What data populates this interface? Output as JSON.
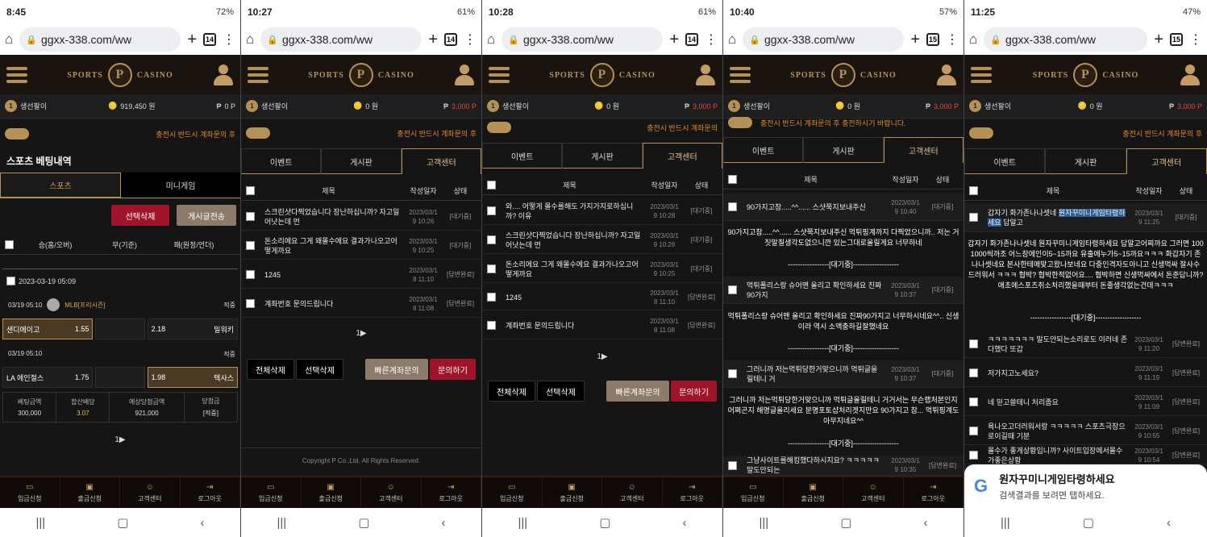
{
  "phones": [
    {
      "time": "8:45",
      "battery": "72%",
      "url": "ggxx-338.com/ww",
      "tabs": "14",
      "nick": "생선팔이",
      "money": "919,450 원",
      "points": "0 P"
    },
    {
      "time": "10:27",
      "battery": "61%",
      "url": "ggxx-338.com/ww",
      "tabs": "14",
      "nick": "생선팔이",
      "money": "0 원",
      "points": "3,000 P"
    },
    {
      "time": "10:28",
      "battery": "61%",
      "url": "ggxx-338.com/ww",
      "tabs": "14",
      "nick": "생선팔이",
      "money": "0 원",
      "points": "3,000 P"
    },
    {
      "time": "10:40",
      "battery": "57%",
      "url": "ggxx-338.com/ww",
      "tabs": "15",
      "nick": "생선팔이",
      "money": "0 원",
      "points": "3,000 P"
    },
    {
      "time": "11:25",
      "battery": "47%",
      "url": "ggxx-338.com/ww",
      "tabs": "15",
      "nick": "생선팔이",
      "money": "0 원",
      "points": "3,000 P"
    }
  ],
  "brand": {
    "left": "SPORTS",
    "right": "CASINO",
    "seal": "P"
  },
  "notice": "충전시 반드시 계좌문의 후 충전하시기 바랍니다.",
  "notice_short": "충전시 반드시 계좌문의 후",
  "notice_mid": "충전시 반드시 계좌문의",
  "sports": {
    "title": "스포츠 베팅내역",
    "tab_sports": "스포츠",
    "tab_mini": "미니게임",
    "btn_delete": "선택삭제",
    "btn_send": "게시글전송",
    "h_home": "승(홈/오버)",
    "h_draw": "무(기준)",
    "h_away": "패(원정/언더)",
    "date": "2023-03-19 05:09",
    "g1_time": "03/19  05:10",
    "g1_league": "MLB[프리시즌]",
    "g1_status": "적중",
    "g1_home": "샌디에이고",
    "g1_home_odd": "1.55",
    "g1_away_odd": "2.18",
    "g1_away": "밀워키",
    "g2_time": "03/19  05:10",
    "g2_status": "적중",
    "g2_home": "LA 에인절스",
    "g2_home_odd": "1.75",
    "g2_away_odd": "1.98",
    "g2_away": "텍사스",
    "s_bet": "베팅금액",
    "s_bet_v": "300,000",
    "s_odds": "합산배당",
    "s_odds_v": "3.07",
    "s_exp": "예상당첨금액",
    "s_exp_v": "921,000",
    "s_win": "당첨금",
    "s_win_v": "[적중]",
    "pager": "1▶"
  },
  "tabs": {
    "event": "이벤트",
    "board": "게시판",
    "cs": "고객센터"
  },
  "thead": {
    "title": "제목",
    "date": "작성일자",
    "status": "상태"
  },
  "p2rows": [
    {
      "t": "스크린샷다찍었습니다 장난하십니까? 자고일어낫는데 먼",
      "d1": "2023/03/1",
      "d2": "9 10:26",
      "s": "[대기중]"
    },
    {
      "t": "돈소리에요 그게 왜몰수에요 결과가나오고어떻게까요",
      "d1": "2023/03/1",
      "d2": "9 10:25",
      "s": "[대기중]"
    },
    {
      "t": "1245",
      "d1": "2023/03/1",
      "d2": "8 11:10",
      "s": "[답변완료]"
    },
    {
      "t": "계좌번호 문의드립니다",
      "d1": "2023/03/1",
      "d2": "8 11:08",
      "s": "[답변완료]"
    }
  ],
  "p3rows": [
    {
      "t": "와.... 어떻게 몰수를해도 가지가지로하십니까? 이유",
      "d1": "2023/03/1",
      "d2": "9 10:28",
      "s": "[대기중]"
    },
    {
      "t": "스크린샷다찍었습니다 장난하십니까? 자고일어낫는데 먼",
      "d1": "2023/03/1",
      "d2": "9 10:26",
      "s": "[대기중]"
    },
    {
      "t": "돈소리에요 그게 왜몰수에요 결과가나오고어떻게까요",
      "d1": "2023/03/1",
      "d2": "9 10:25",
      "s": "[대기중]"
    },
    {
      "t": "1245",
      "d1": "2023/03/1",
      "d2": "8 11:10",
      "s": "[답변완료]"
    },
    {
      "t": "계좌번호 문의드립니다",
      "d1": "2023/03/1",
      "d2": "8 11:08",
      "s": "[답변완료]"
    }
  ],
  "board_btns": {
    "all": "전체삭제",
    "sel": "선택삭제",
    "quick": "빠른계좌문의",
    "ask": "문의하기"
  },
  "pager": "1▶",
  "copyright": "Copyright P Co.,Ltd. All Rights Reserved.",
  "p4": {
    "r1": "90가지고참.....^^...... 스샷쭉지보내주신",
    "r1d1": "2023/03/1",
    "r1d2": "9 10:40",
    "r1s": "[대기중]",
    "b1": "90가지고참.....^^...... 스샷쭉지보내주신 먹튀핑계까지 다찍었으니까.. 저는 거짓말칠생각도없으니깐 있는그대로올릴게요 너무하네",
    "wait": "-----------------[대기중]-------------------",
    "r2": "먹튀폴리스랑 슈어맨 올리고 확인하세요 진짜 90가지",
    "r2d1": "2023/03/1",
    "r2d2": "9 10:37",
    "r2s": "[대기중]",
    "b2": "먹튀폴리스랑 슈어맨 올리고 확인하세요 진짜90가지고 너무하시네요^^.. 신생이라 역시 소액충하길잘했네요",
    "r3": "그러니까 저는먹튀당한거맞으니까 먹튀글을 릴테니 거",
    "r3d1": "2023/03/1",
    "r3d2": "9 10:37",
    "r3s": "[대기중]",
    "b3": "그러니까 저는먹튀당한거맞으니까 먹튀글올릴테니 거거서는 무슨랩처본인지 어쩌곤지 해명글올리세요 분명포토샵처리겟지만요 90가지고 참... 먹튀핑계도아무지네요^^",
    "r4": "그냥사이트를해킹했다하시지요? ㅋㅋㅋㅋㅋ 말도안되는",
    "r4d1": "2023/03/1",
    "r4d2": "9 10:35",
    "r4s": "[답변완료]"
  },
  "p5": {
    "r1a": "갑자기 화가존나나셋네 ",
    "r1hl": "원자꾸미니게임타령하세요",
    "r1b": " 답알고",
    "r1d1": "2023/03/1",
    "r1d2": "9 11:25",
    "r1s": "[대기중]",
    "b1": "갑자기 화가존나나셋네 원자꾸미니게임타령하세요 답알고어찌까요 그러면 100 1000씩까조 어느장에인이5~15까요 유출에누가5~15까요ㅋㅋㅋ 화갑자기 존나나셋네요 본사한테매맞고왔나보네요 다중인격자도아니고 신생먹싸 잘사수 드러워서 ㅋㅋㅋ 협박? 협박한적없어요.... 협박하면 신생먹싸에서 돈준답니까? 애초에스포츠취소처리했을때부터 돈줄생각없는건데ㅋㅋㅋ",
    "wait": "-----------------[대기중]-------------------",
    "rows": [
      {
        "t": "ㅋㅋㅋㅋㅋㅋㅋ 말도안되는소리로도 이러네 존다했다 또갑",
        "d1": "2023/03/1",
        "d2": "9 11:20",
        "s": "[답변완료]"
      },
      {
        "t": "저가지고노세요?",
        "d1": "2023/03/1",
        "d2": "9 11:19",
        "s": "[답변완료]"
      },
      {
        "t": "네 믿고쓸테니 처리좀요",
        "d1": "2023/03/1",
        "d2": "9 11:09",
        "s": "[답변완료]"
      },
      {
        "t": "욕나오고더러워서랑 ㅋㅋㅋㅋㅋ 스포츠극장으로이길때 기분",
        "d1": "2023/03/1",
        "d2": "9 10:55",
        "s": "[답변완료]"
      },
      {
        "t": "몰수가 좋게상황입니까? 사이트입장에서몰수가좋은상황",
        "d1": "2023/03/1",
        "d2": "9 10:54",
        "s": "[답변완료]"
      }
    ],
    "toast_title": "원자꾸미니게임타령하세요",
    "toast_sub": "검색결과를 보려면 탭하세요."
  },
  "bottomnav": {
    "deposit": "입금신청",
    "withdraw": "출금신청",
    "cs": "고객센터",
    "logout": "로그아웃"
  }
}
